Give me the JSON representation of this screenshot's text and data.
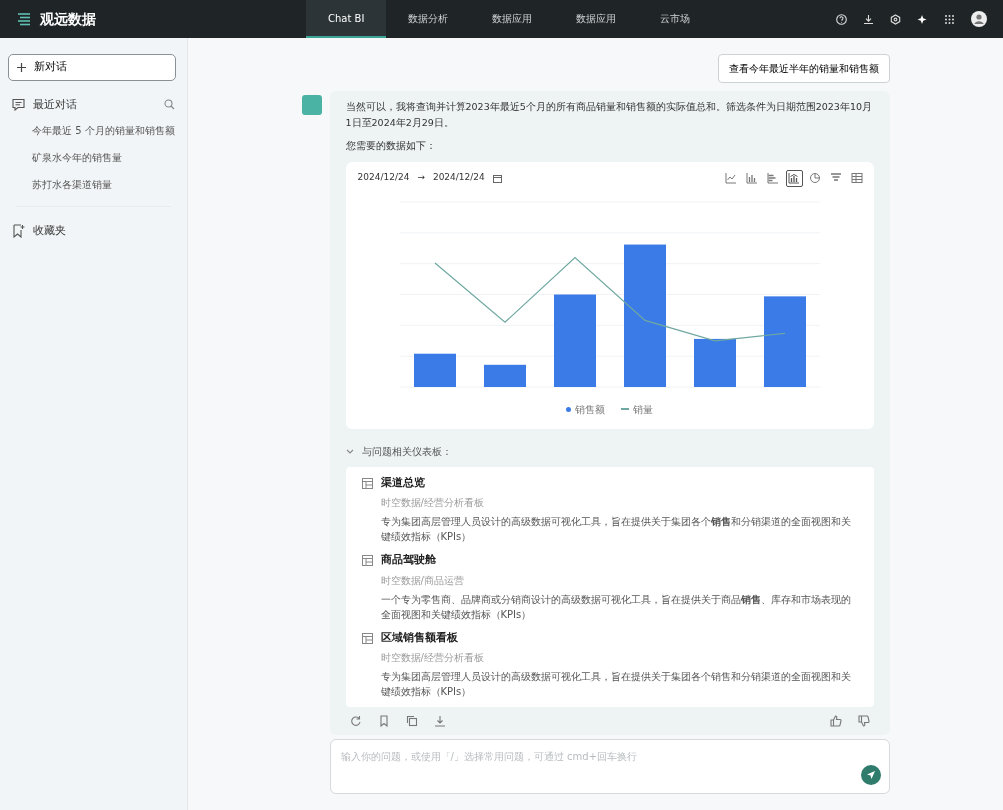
{
  "topbar": {
    "brand": "观远数据",
    "tabs": [
      {
        "label": "Chat BI",
        "selected": true
      },
      {
        "label": "数据分析",
        "selected": false
      },
      {
        "label": "数据应用",
        "selected": false
      },
      {
        "label": "数据应用",
        "selected": false
      },
      {
        "label": "云市场",
        "selected": false
      }
    ]
  },
  "sidebar": {
    "new_chat": "新对话",
    "recent_title": "最近对话",
    "recent_items": [
      "今年最近 5 个月的销量和销售额",
      "矿泉水今年的销售量",
      "苏打水各渠道销量"
    ],
    "favorites": "收藏夹"
  },
  "user_message": "查看今年最近半年的销量和销售额",
  "reply": {
    "text": "当然可以，我将查询并计算2023年最近5个月的所有商品销量和销售额的实际值总和。筛选条件为日期范围2023年10月1日至2024年2月29日。",
    "lead": "您需要的数据如下：",
    "date_from": "2024/12/24",
    "date_sep": "→",
    "date_to": "2024/12/24",
    "chart_types": [
      {
        "kind": "line",
        "selected": false
      },
      {
        "kind": "column",
        "selected": false
      },
      {
        "kind": "bar",
        "selected": false
      },
      {
        "kind": "combo",
        "selected": true
      },
      {
        "kind": "pie",
        "selected": false
      },
      {
        "kind": "funnel",
        "selected": false
      },
      {
        "kind": "table",
        "selected": false
      }
    ],
    "chart": {
      "kind": "picture",
      "legend": [
        {
          "name": "销售额",
          "color": "#3b7be8",
          "kind": "bar"
        },
        {
          "name": "销量",
          "color": "#6fa8a0",
          "kind": "line"
        }
      ]
    },
    "related_title": "与问题相关仪表板：",
    "dashboards": [
      {
        "title": "渠道总览",
        "path": "时空数据/经营分析看板",
        "desc": "专为集团高层管理人员设计的高级数据可视化工具，旨在提供关于集团各个**销售**和分销渠道的全面视图和关键绩效指标（KPIs）"
      },
      {
        "title": "商品驾驶舱",
        "path": "时空数据/商品运营",
        "desc": "一个专为零售商、品牌商或分销商设计的高级数据可视化工具，旨在提供关于商品**销售**、库存和市场表现的全面视图和关键绩效指标（KPIs）"
      },
      {
        "title": "区域销售额看板",
        "path": "时空数据/经营分析看板",
        "desc": "专为集团高层管理人员设计的高级数据可视化工具，旨在提供关于集团各个销售和分销渠道的全面视图和关键绩效指标（KPIs）"
      }
    ]
  },
  "composer": {
    "placeholder": "输入你的问题，或使用「/」选择常用问题，可通过 cmd+回车换行"
  }
}
